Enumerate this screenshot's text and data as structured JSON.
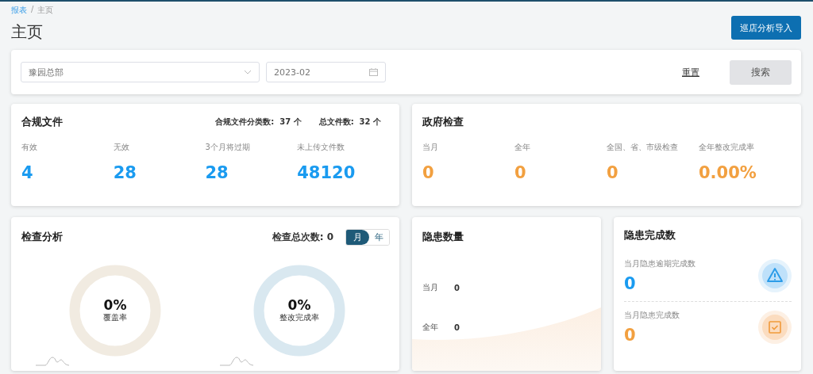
{
  "breadcrumb": [
    {
      "label": "报表",
      "link": true
    },
    {
      "label": "主页",
      "link": false
    }
  ],
  "breadcrumb_separator": "/",
  "title": "主页",
  "import_button": "巡店分析导入",
  "filters": {
    "store": "豫园总部",
    "month": "2023-02",
    "reset": "重置",
    "search": "搜索"
  },
  "compliance": {
    "title": "合规文件",
    "summary": [
      {
        "label": "合规文件分类数:",
        "value": "37 个"
      },
      {
        "label": "总文件数:",
        "value": "32 个"
      }
    ],
    "stats": [
      {
        "label": "有效",
        "value": "4"
      },
      {
        "label": "无效",
        "value": "28"
      },
      {
        "label": "3个月将过期",
        "value": "28"
      },
      {
        "label": "未上传文件数",
        "value": "48120"
      }
    ]
  },
  "government": {
    "title": "政府检查",
    "stats": [
      {
        "label": "当月",
        "value": "0"
      },
      {
        "label": "全年",
        "value": "0"
      },
      {
        "label": "全国、省、市级检查",
        "value": "0"
      },
      {
        "label": "全年整改完成率",
        "value": "0.00%"
      }
    ]
  },
  "inspection": {
    "title": "检查分析",
    "total_label": "检查总次数:",
    "total": "0",
    "toggle": [
      {
        "label": "月",
        "selected": true
      },
      {
        "label": "年",
        "selected": false
      }
    ],
    "gauges": [
      {
        "value": "0%",
        "label": "覆盖率",
        "color": "#f1ebe1"
      },
      {
        "value": "0%",
        "label": "整改完成率",
        "color": "#d9e8f0"
      }
    ]
  },
  "hazard_count": {
    "title": "隐患数量",
    "rows": [
      {
        "label": "当月",
        "value": "0"
      },
      {
        "label": "全年",
        "value": "0"
      }
    ]
  },
  "hazard_done": {
    "title": "隐患完成数",
    "items": [
      {
        "label": "当月隐患逾期完成数",
        "value": "0",
        "kind": "warning"
      },
      {
        "label": "当月隐患完成数",
        "value": "0",
        "kind": "done"
      }
    ]
  }
}
